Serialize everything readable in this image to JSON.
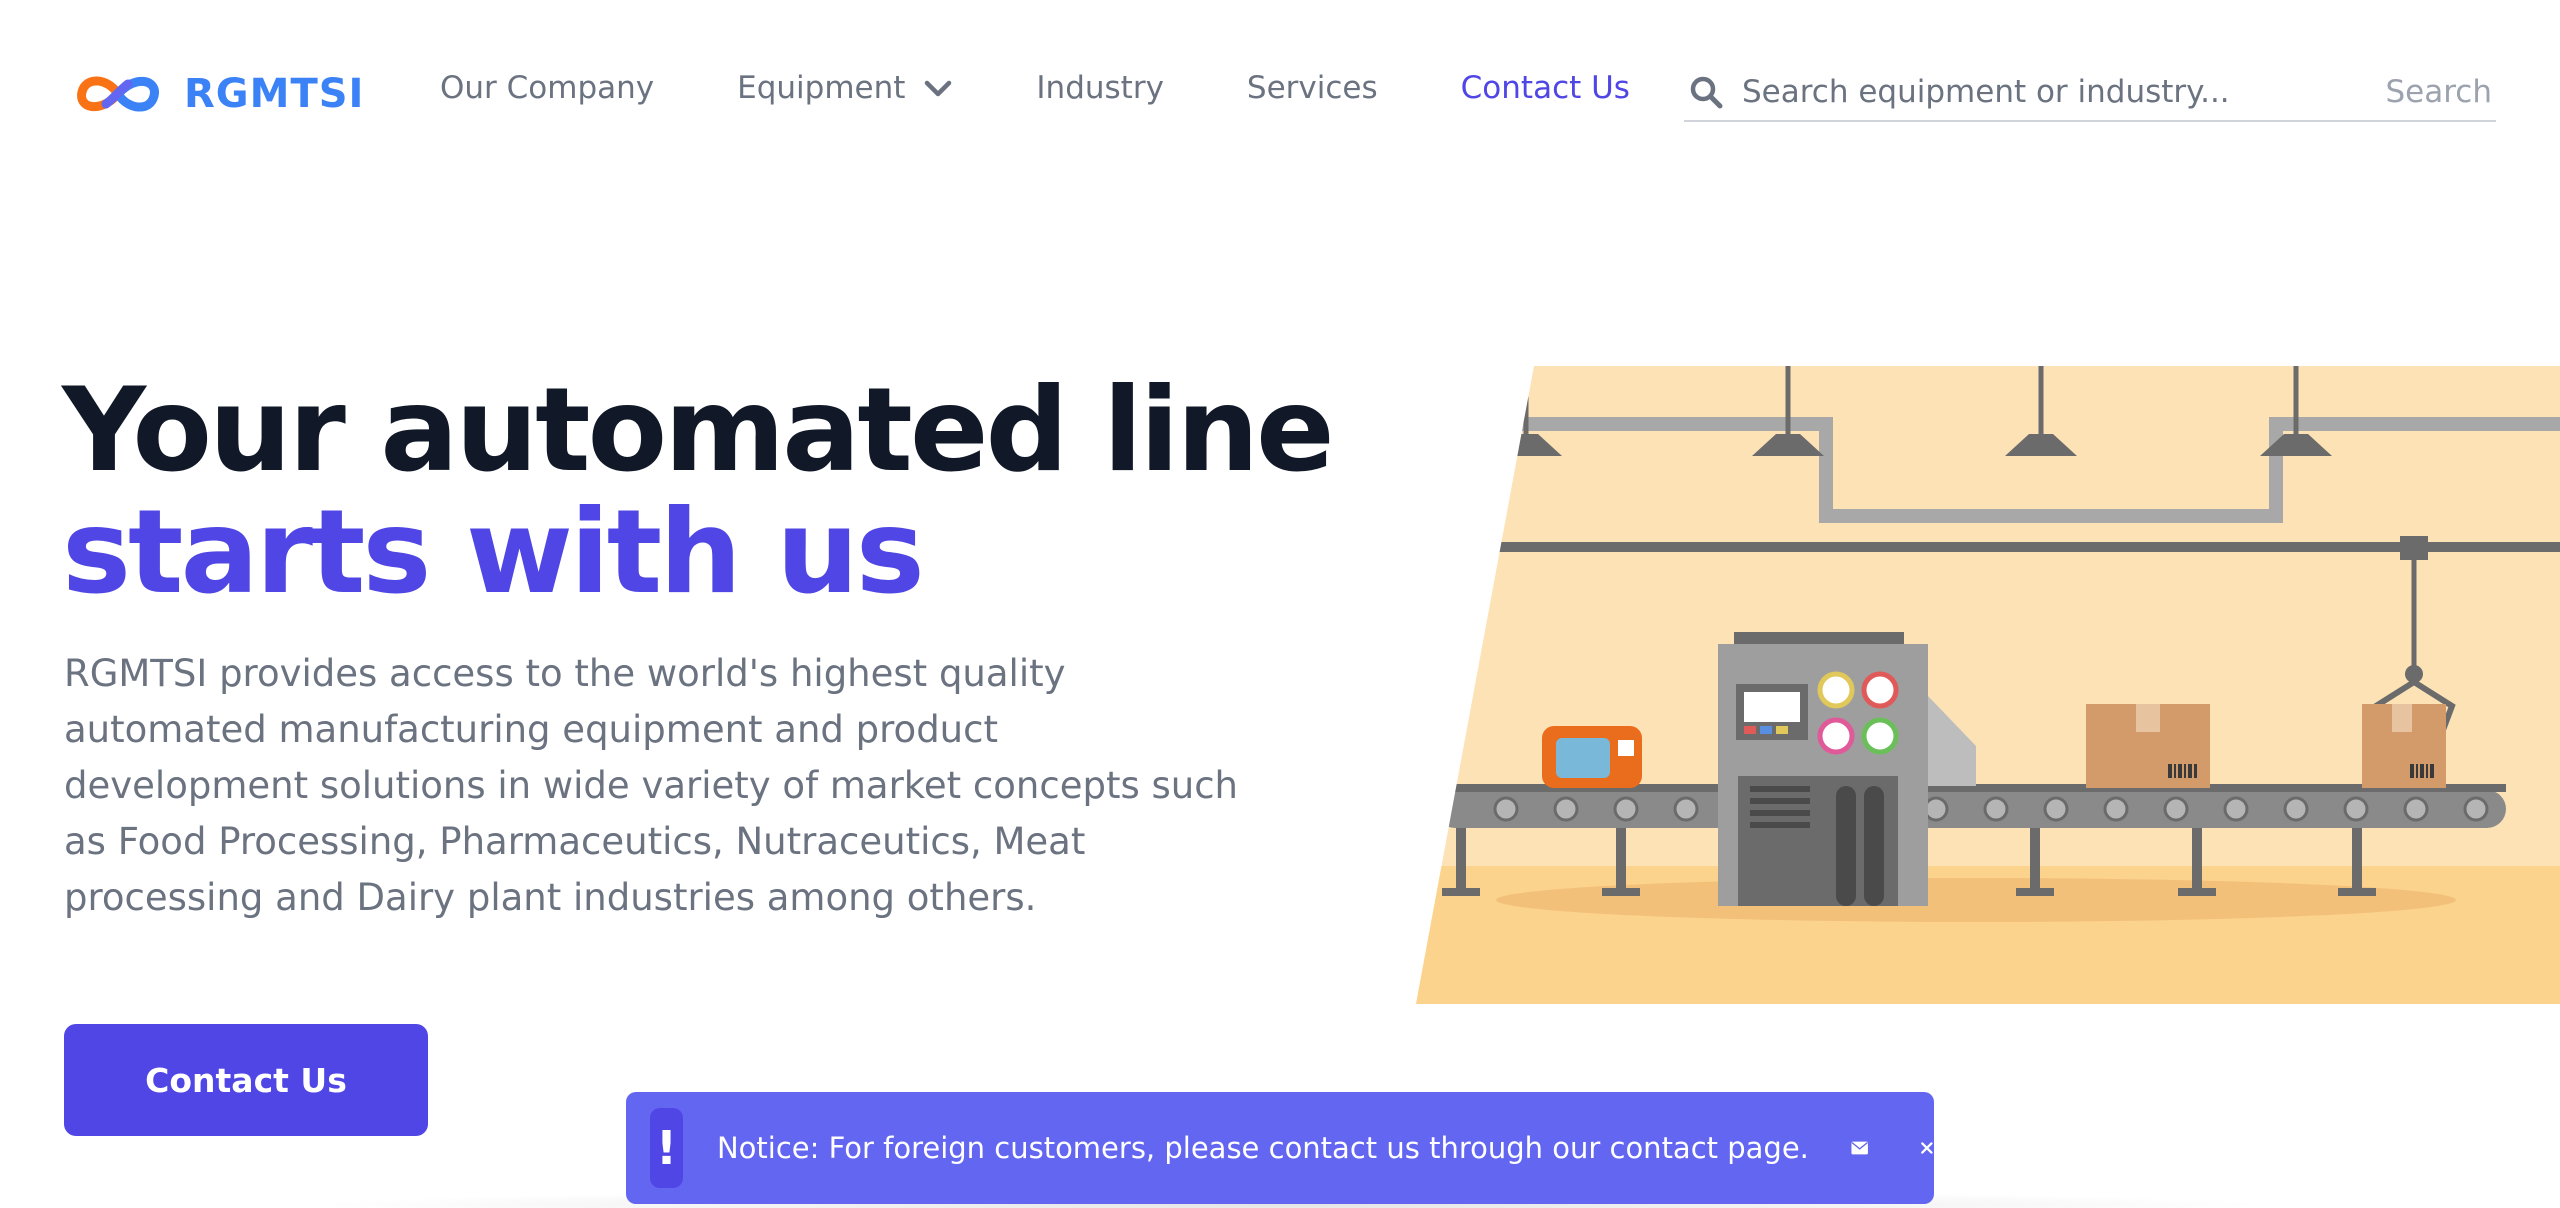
{
  "brand": {
    "name": "RGMTSI",
    "color": "#3b82f6"
  },
  "nav": {
    "items": [
      {
        "label": "Our Company"
      },
      {
        "label": "Equipment",
        "has_dropdown": true
      },
      {
        "label": "Industry"
      },
      {
        "label": "Services"
      },
      {
        "label": "Contact Us",
        "active": true
      }
    ]
  },
  "search": {
    "placeholder": "Search equipment or industry...",
    "value": "",
    "button_label": "Search"
  },
  "hero": {
    "title_line1": "Your automated line",
    "title_line2": "starts with us",
    "description": "RGMTSI provides access to the world's highest quality automated manufacturing equipment and product development solutions in wide variety of market concepts such as Food Processing, Pharmaceutics, Nutraceutics, Meat processing and Dairy plant industries among others.",
    "cta_label": "Contact Us"
  },
  "notice": {
    "badge": "!",
    "text": "Notice: For foreign customers, please contact us through our contact page.",
    "icons": [
      "envelope-icon",
      "close-icon"
    ]
  },
  "colors": {
    "accent": "#4f46e5",
    "notice_bg": "#6366f1",
    "heading": "#111827",
    "body_text": "#6b7280",
    "illustration_bg": "#fde2b6"
  }
}
